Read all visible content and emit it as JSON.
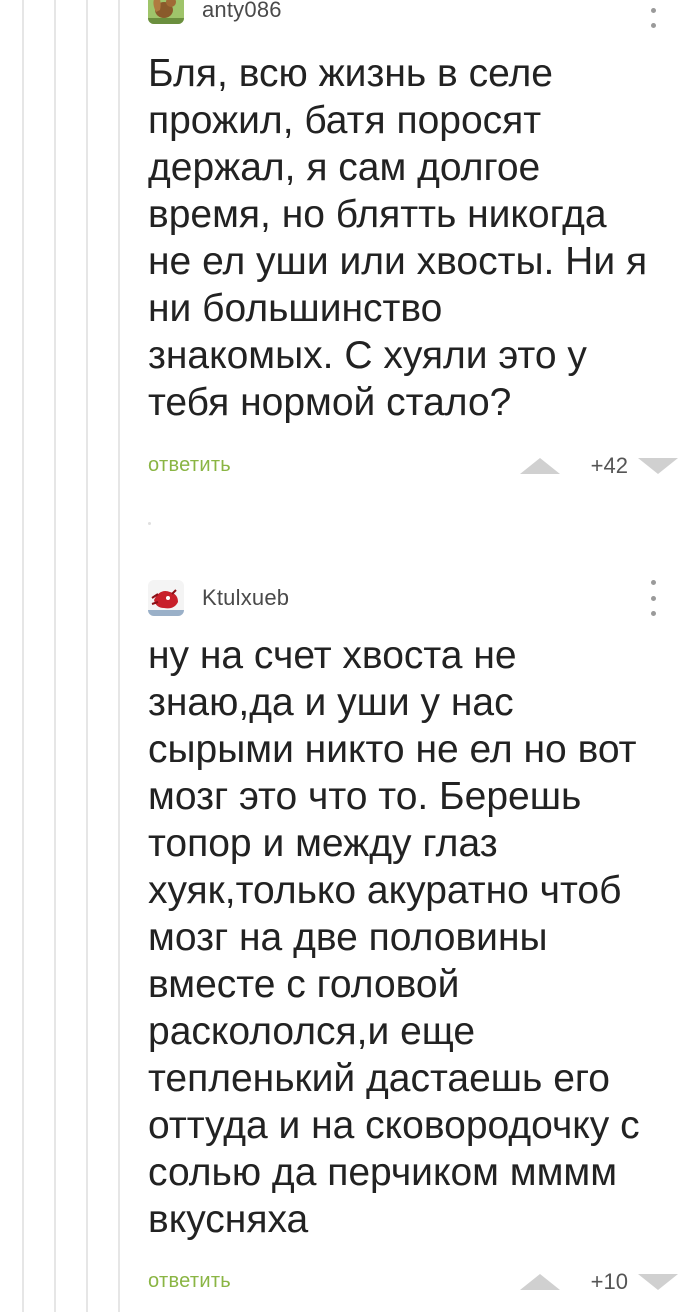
{
  "comments": [
    {
      "username": "anty086",
      "avatar_icon": "squirrel-avatar-icon",
      "text": "Бля, всю жизнь в селе\nпрожил,  батя поросят\nдержал, я сам долгое\nвремя, но блятть никогда\nне ел уши или хвосты. Ни я\nни большинство\nзнакомых. С хуяли это у\nтебя нормой стало?",
      "reply_label": "ответить",
      "rating": "+42"
    },
    {
      "username": "Ktulxueb",
      "avatar_icon": "red-creature-avatar-icon",
      "text": "ну на счет хвоста не\nзнаю,да и уши у нас\nсырыми никто не ел но вот\nмозг это что то. Берешь\nтопор и между глаз\nхуяк,только акуратно чтоб\nмозг на две половины\nвместе с головой\nраскололся,и еще\nтепленький дастаешь его\nоттуда и на сковородочку с\nсолью да перчиком мммм\nвкусняха",
      "reply_label": "ответить",
      "rating": "+10"
    }
  ],
  "colors": {
    "reply_link": "#8ab544",
    "vote_arrow": "#d0d0d0",
    "thread_line": "#e6e6e6",
    "body_text": "#222222"
  },
  "icons": [
    "kebab-menu-icon",
    "vote-up-icon",
    "vote-down-icon"
  ]
}
